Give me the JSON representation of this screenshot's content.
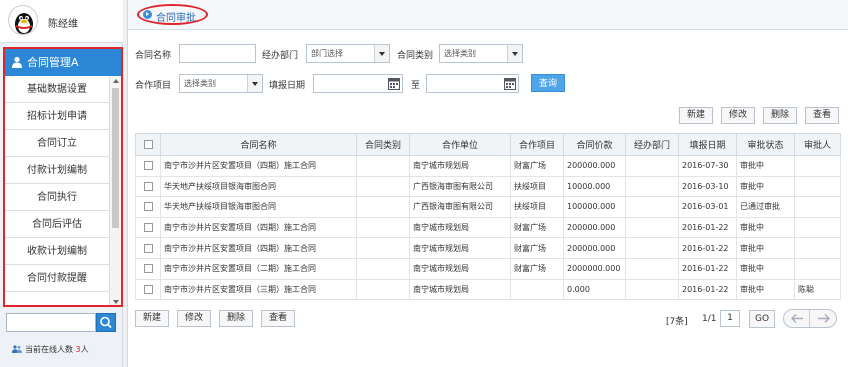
{
  "user": {
    "name": "陈经维"
  },
  "menu": {
    "title": "合同管理A",
    "items": [
      "基础数据设置",
      "招标计划申请",
      "合同订立",
      "付款计划编制",
      "合同执行",
      "合同后评估",
      "收款计划编制",
      "合同付款提醒"
    ]
  },
  "sidebar_search": {
    "placeholder": ""
  },
  "online": {
    "label": "当前在线人数",
    "count": "3",
    "unit": "人"
  },
  "tab": {
    "label": "合同审批"
  },
  "filters": {
    "name_label": "合同名称",
    "name_value": "",
    "dept_label": "经办部门",
    "dept_value": "部门选择",
    "type_label": "合同类别",
    "type_value": "选择类别",
    "project_label": "合作项目",
    "project_value": "选择类别",
    "date_label": "填报日期",
    "date_to_label": "至",
    "query_label": "查询"
  },
  "toolbar": {
    "new": "新建",
    "edit": "修改",
    "delete": "删除",
    "view": "查看"
  },
  "table": {
    "columns": [
      "合同名称",
      "合同类别",
      "合作单位",
      "合作项目",
      "合同价款",
      "经办部门",
      "填报日期",
      "审批状态",
      "审批人"
    ],
    "rows": [
      [
        "南宁市沙井片区安置项目（四期）施工合同",
        "",
        "南宁城市规划局",
        "财富广场",
        "200000.000",
        "",
        "2016-07-30",
        "审批中",
        ""
      ],
      [
        "华天地产扶绥项目银海审图合同",
        "",
        "广西银海审图有限公司",
        "扶绥项目",
        "10000.000",
        "",
        "2016-03-10",
        "审批中",
        ""
      ],
      [
        "华天地产扶绥项目银海审图合同",
        "",
        "广西银海审图有限公司",
        "扶绥项目",
        "100000.000",
        "",
        "2016-03-01",
        "已通过审批",
        ""
      ],
      [
        "南宁市沙井片区安置项目（四期）施工合同",
        "",
        "南宁城市规划局",
        "财富广场",
        "200000.000",
        "",
        "2016-01-22",
        "审批中",
        ""
      ],
      [
        "南宁市沙井片区安置项目（四期）施工合同",
        "",
        "南宁城市规划局",
        "财富广场",
        "200000.000",
        "",
        "2016-01-22",
        "审批中",
        ""
      ],
      [
        "南宁市沙井片区安置项目（二期）施工合同",
        "",
        "南宁城市规划局",
        "财富广场",
        "2000000.000",
        "",
        "2016-01-22",
        "审批中",
        ""
      ],
      [
        "南宁市沙井片区安置项目（三期）施工合同",
        "",
        "南宁城市规划局",
        "",
        "0.000",
        "",
        "2016-01-22",
        "审批中",
        "陈聪"
      ]
    ]
  },
  "pager": {
    "total": "[7条]",
    "position": "1/1",
    "page": "1",
    "go": "GO"
  },
  "colors": {
    "accent": "#2c88d6",
    "highlight": "#e0262c",
    "query": "#4ea6ea"
  },
  "icons": [
    "qq-penguin-avatar",
    "user-icon",
    "search-icon",
    "people-icon",
    "arrow-circle-icon",
    "calendar-icon",
    "dropdown-arrow-icon",
    "prev-arrow-icon",
    "next-arrow-icon"
  ]
}
